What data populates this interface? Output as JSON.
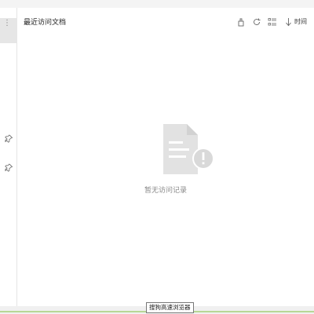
{
  "main": {
    "title": "最近访问文档",
    "sort_label": "时间",
    "empty_text": "暂无访问记录"
  },
  "tooltip": {
    "text": "搜狗高速浏览器"
  },
  "icons": {
    "sidebar_more": "more-vertical-icon",
    "pin_1": "pin-icon",
    "pin_2": "pin-icon",
    "clear": "clear-icon",
    "refresh": "refresh-icon",
    "list_view": "list-view-icon",
    "sort": "sort-down-icon",
    "empty": "empty-document-icon"
  },
  "colors": {
    "accent_green": "#8bc34a",
    "muted_text": "#888888",
    "placeholder_gray": "#e2e2e2"
  }
}
